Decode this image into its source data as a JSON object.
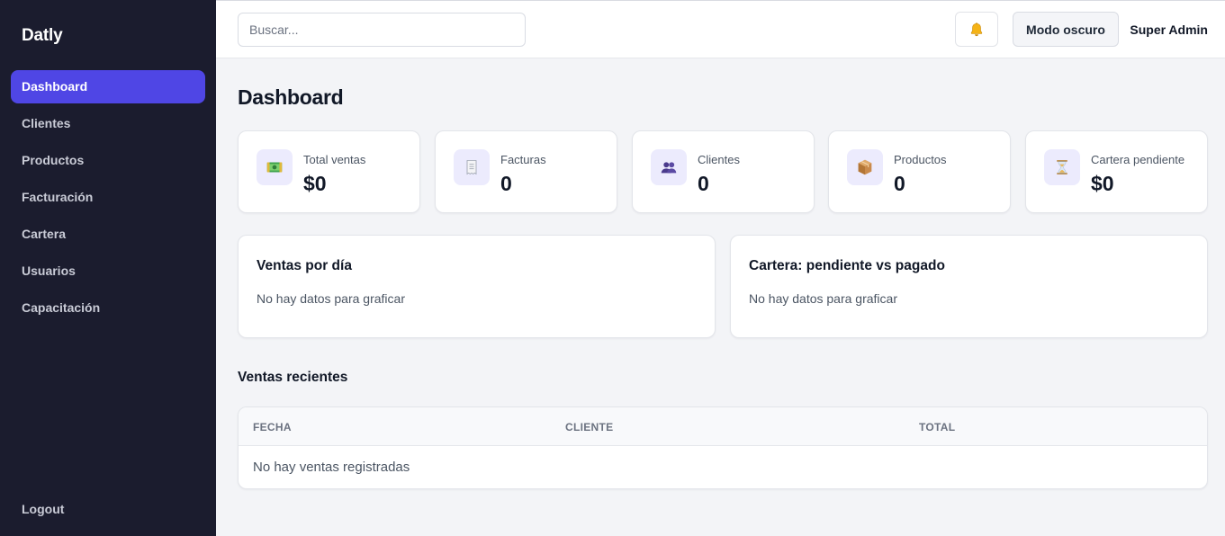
{
  "sidebar": {
    "brand": "Datly",
    "items": [
      {
        "label": "Dashboard",
        "active": true
      },
      {
        "label": "Clientes"
      },
      {
        "label": "Productos"
      },
      {
        "label": "Facturación"
      },
      {
        "label": "Cartera"
      },
      {
        "label": "Usuarios"
      },
      {
        "label": "Capacitación"
      }
    ],
    "logout": "Logout",
    "colors": {
      "background": "#1b1c2e",
      "active": "#4f46e5"
    }
  },
  "topbar": {
    "search_placeholder": "Buscar...",
    "bell_icon": "bell-icon",
    "dark_mode_label": "Modo oscuro",
    "user_name": "Super Admin"
  },
  "main": {
    "title": "Dashboard",
    "stats": [
      {
        "label": "Total ventas",
        "value": "$0",
        "icon": "money-icon"
      },
      {
        "label": "Facturas",
        "value": "0",
        "icon": "receipt-icon"
      },
      {
        "label": "Clientes",
        "value": "0",
        "icon": "users-icon"
      },
      {
        "label": "Productos",
        "value": "0",
        "icon": "package-icon"
      },
      {
        "label": "Cartera pendiente",
        "value": "$0",
        "icon": "hourglass-icon"
      }
    ],
    "charts": [
      {
        "title": "Ventas por día",
        "empty": "No hay datos para graficar"
      },
      {
        "title": "Cartera: pendiente vs pagado",
        "empty": "No hay datos para graficar"
      }
    ],
    "recent_sales": {
      "title": "Ventas recientes",
      "columns": [
        "FECHA",
        "CLIENTE",
        "TOTAL"
      ],
      "empty": "No hay ventas registradas"
    }
  }
}
